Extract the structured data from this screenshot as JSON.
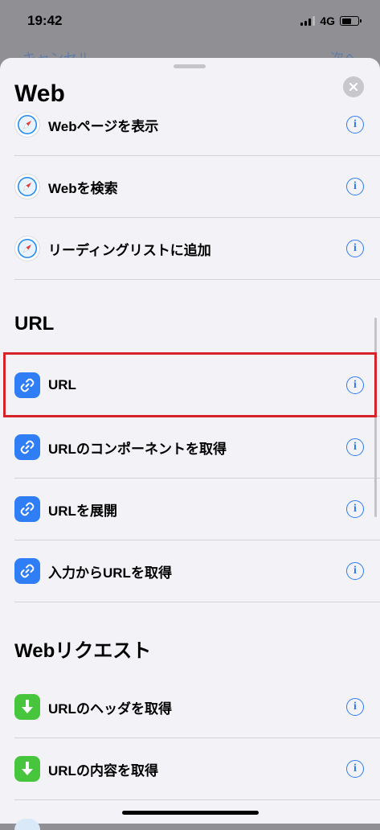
{
  "status": {
    "time": "19:42",
    "network": "4G"
  },
  "behind": {
    "left": "キャンセル",
    "right": "次へ"
  },
  "sheet": {
    "title": "Web",
    "rows_web": [
      {
        "label": "Webページを表示",
        "icon": "safari-icon"
      },
      {
        "label": "Webを検索",
        "icon": "safari-icon"
      },
      {
        "label": "リーディングリストに追加",
        "icon": "safari-icon"
      }
    ],
    "section_url": "URL",
    "rows_url": [
      {
        "label": "URL",
        "icon": "link-icon"
      },
      {
        "label": "URLのコンポーネントを取得",
        "icon": "link-icon"
      },
      {
        "label": "URLを展開",
        "icon": "link-icon"
      },
      {
        "label": "入力からURLを取得",
        "icon": "link-icon"
      }
    ],
    "section_request": "Webリクエスト",
    "rows_request": [
      {
        "label": "URLのヘッダを取得",
        "icon": "download-icon"
      },
      {
        "label": "URLの内容を取得",
        "icon": "download-icon"
      }
    ]
  },
  "colors": {
    "accent": "#2e7cf6",
    "highlight": "#d6232a",
    "download": "#47c63d",
    "link": "#2f7ef5"
  }
}
